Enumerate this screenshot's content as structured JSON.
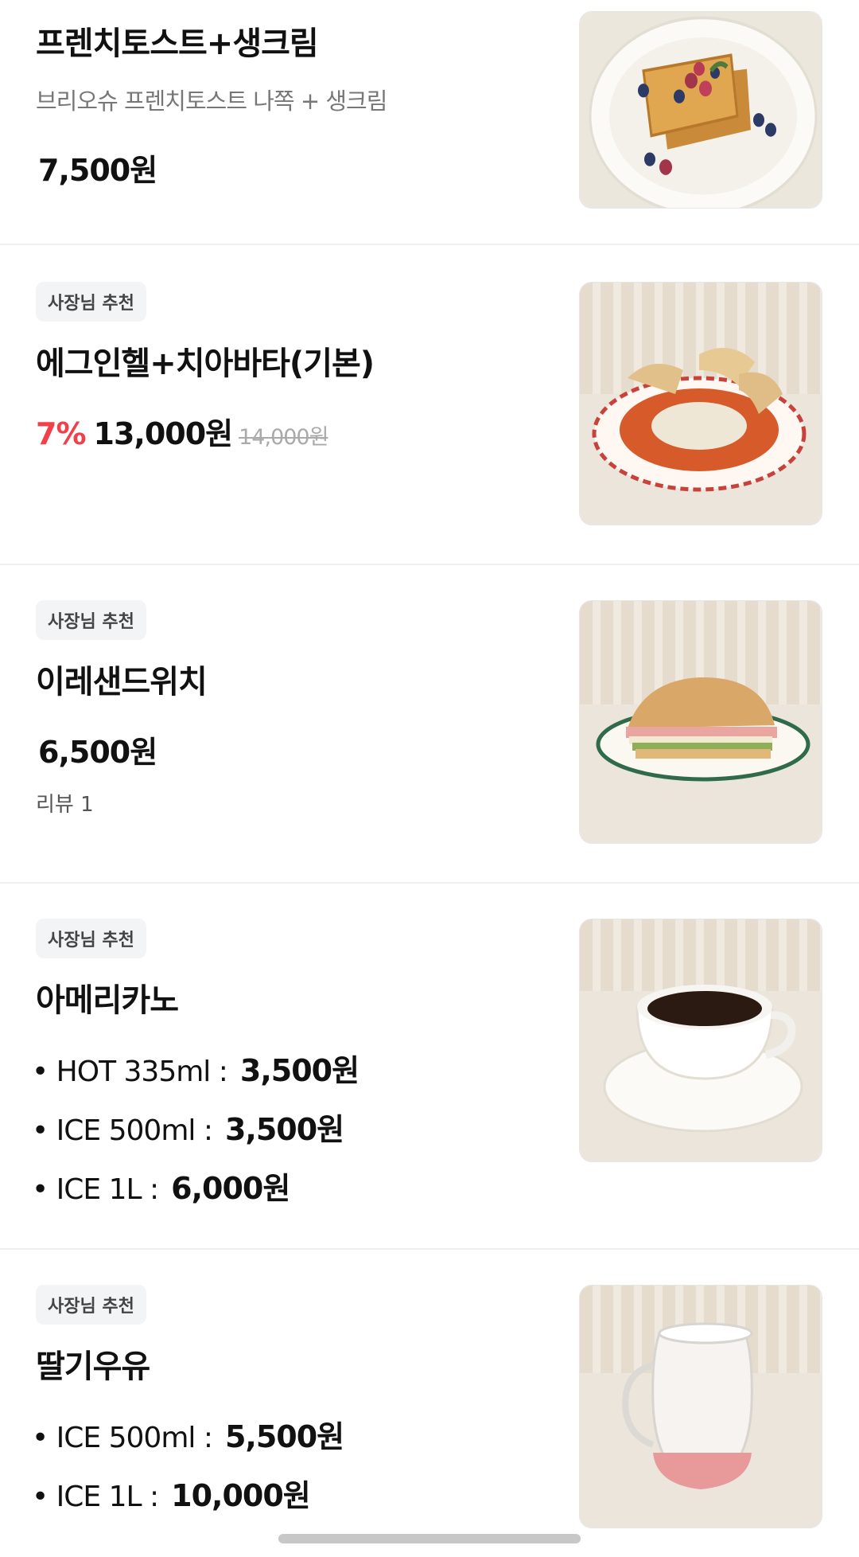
{
  "items": [
    {
      "name": "프렌치토스트+생크림",
      "description": "브리오슈 프렌치토스트 나쪽 + 생크림",
      "price": "7,500원",
      "image": "french-toast-photo"
    },
    {
      "badge": "사장님 추천",
      "name": "에그인헬+치아바타(기본)",
      "discount": "7%",
      "price": "13,000원",
      "original_price": "14,000원",
      "image": "egg-in-hell-photo"
    },
    {
      "badge": "사장님 추천",
      "name": "이레샌드위치",
      "price": "6,500원",
      "review": "리뷰 1",
      "image": "sandwich-photo"
    },
    {
      "badge": "사장님 추천",
      "name": "아메리카노",
      "options": [
        {
          "label": "• HOT 335ml :",
          "price": "3,500원"
        },
        {
          "label": "• ICE 500ml :",
          "price": "3,500원"
        },
        {
          "label": "• ICE 1L :",
          "price": "6,000원"
        }
      ],
      "image": "americano-photo"
    },
    {
      "badge": "사장님 추천",
      "name": "딸기우유",
      "options": [
        {
          "label": "• ICE 500ml :",
          "price": "5,500원"
        },
        {
          "label": "• ICE 1L :",
          "price": "10,000원"
        }
      ],
      "image": "strawberry-milk-photo"
    }
  ],
  "colors": {
    "discount": "#f0404a",
    "badge_bg": "#f3f4f6",
    "divider": "#f0f0f0",
    "text": "#111111",
    "muted": "#777777"
  }
}
